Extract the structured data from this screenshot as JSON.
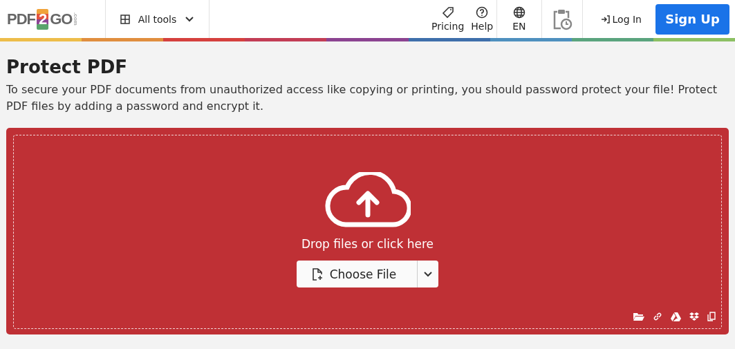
{
  "logo": {
    "left": "PDF",
    "middle": "2",
    "right": "GO",
    "suffix": ".com"
  },
  "nav": {
    "all_tools": "All tools",
    "pricing": "Pricing",
    "help": "Help",
    "language": "EN",
    "login": "Log In",
    "signup": "Sign Up"
  },
  "page": {
    "title": "Protect PDF",
    "description": "To secure your PDF documents from unauthorized access like copying or printing, you should password protect your file! Protect PDF files by adding a password and encrypt it."
  },
  "upload": {
    "prompt": "Drop files or click here",
    "button": "Choose File"
  }
}
